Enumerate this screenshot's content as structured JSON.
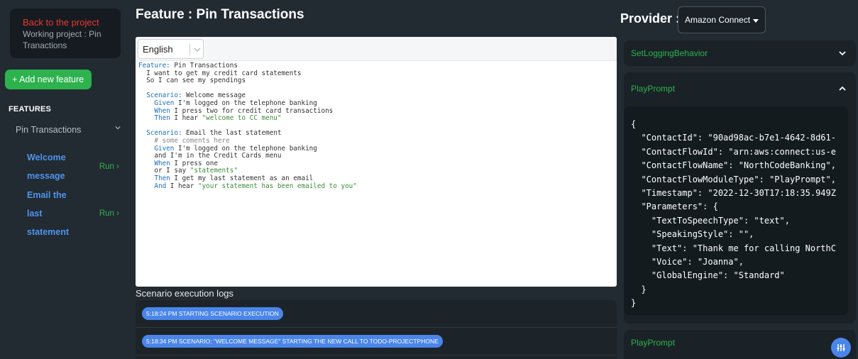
{
  "sidebar": {
    "back_label": "Back to the project",
    "working_project": "Working project : Pin Tranactions",
    "add_feature_label": "+ Add new feature",
    "features_heading": "FEATURES",
    "feature_item": "Pin Transactions",
    "scenarios": [
      {
        "name": "Welcome message",
        "run": "Run"
      },
      {
        "name": "Email the last statement",
        "run": "Run"
      }
    ]
  },
  "main": {
    "title": "Feature : Pin Transactions",
    "language": "English",
    "code_lines": [
      [
        {
          "t": "Feature:",
          "c": "kw"
        },
        {
          "t": " Pin Transactions",
          "c": ""
        }
      ],
      [
        {
          "t": "  I want to get my credit card statements",
          "c": ""
        }
      ],
      [
        {
          "t": "  So I can see my spendings",
          "c": ""
        }
      ],
      [
        {
          "t": "",
          "c": ""
        }
      ],
      [
        {
          "t": "  Scenario:",
          "c": "kw"
        },
        {
          "t": " Welcome message",
          "c": ""
        }
      ],
      [
        {
          "t": "    Given",
          "c": "kw"
        },
        {
          "t": " I'm logged on the telephone banking",
          "c": ""
        }
      ],
      [
        {
          "t": "    When",
          "c": "kw"
        },
        {
          "t": " I press two for credit card transactions",
          "c": ""
        }
      ],
      [
        {
          "t": "    Then",
          "c": "kw"
        },
        {
          "t": " I hear ",
          "c": ""
        },
        {
          "t": "\"welcome to CC menu\"",
          "c": "str"
        }
      ],
      [
        {
          "t": "",
          "c": ""
        }
      ],
      [
        {
          "t": "  Scenario:",
          "c": "kw"
        },
        {
          "t": " Email the last statement",
          "c": ""
        }
      ],
      [
        {
          "t": "    # some coments here",
          "c": "cmt"
        }
      ],
      [
        {
          "t": "    Given",
          "c": "kw"
        },
        {
          "t": " I'm logged on the telephone banking",
          "c": ""
        }
      ],
      [
        {
          "t": "    and I'm in the Credit Cards menu",
          "c": ""
        }
      ],
      [
        {
          "t": "    When",
          "c": "kw"
        },
        {
          "t": " I press one",
          "c": ""
        }
      ],
      [
        {
          "t": "    or I say ",
          "c": ""
        },
        {
          "t": "\"statements\"",
          "c": "str"
        }
      ],
      [
        {
          "t": "    Then",
          "c": "kw"
        },
        {
          "t": " I get my last statement as an email",
          "c": ""
        }
      ],
      [
        {
          "t": "    And",
          "c": "kw"
        },
        {
          "t": " I hear ",
          "c": ""
        },
        {
          "t": "\"your statement has been emailed to you\"",
          "c": "str"
        }
      ]
    ],
    "logs_title": "Scenario execution logs",
    "logs": [
      "5:18:24 PM STARTING SCENARIO EXECUTION",
      "5:18:34 PM SCENARIO: \"WELCOME MESSAGE\" STARTING THE NEW CALL TO TODO-PROJECTPHONE"
    ]
  },
  "right": {
    "provider_label": "Provider :",
    "provider_value": "Amazon Connect",
    "accordions": [
      "SetLoggingBehavior",
      "PlayPrompt",
      "PlayPrompt"
    ],
    "json_lines": [
      "{",
      "  \"ContactId\": \"90ad98ac-b7e1-4642-8d61-",
      "  \"ContactFlowId\": \"arn:aws:connect:us-e",
      "  \"ContactFlowName\": \"NorthCodeBanking\",",
      "  \"ContactFlowModuleType\": \"PlayPrompt\",",
      "  \"Timestamp\": \"2022-12-30T17:18:35.949Z",
      "  \"Parameters\": {",
      "    \"TextToSpeechType\": \"text\",",
      "    \"SpeakingStyle\": \"\",",
      "    \"Text\": \"Thank me for calling NorthC",
      "    \"Voice\": \"Joanna\",",
      "    \"GlobalEngine\": \"Standard\"",
      "  }",
      "}"
    ]
  },
  "colors": {
    "accent_green": "#2db24e",
    "accent_blue": "#4a85ea",
    "back_red": "#e9382e"
  }
}
